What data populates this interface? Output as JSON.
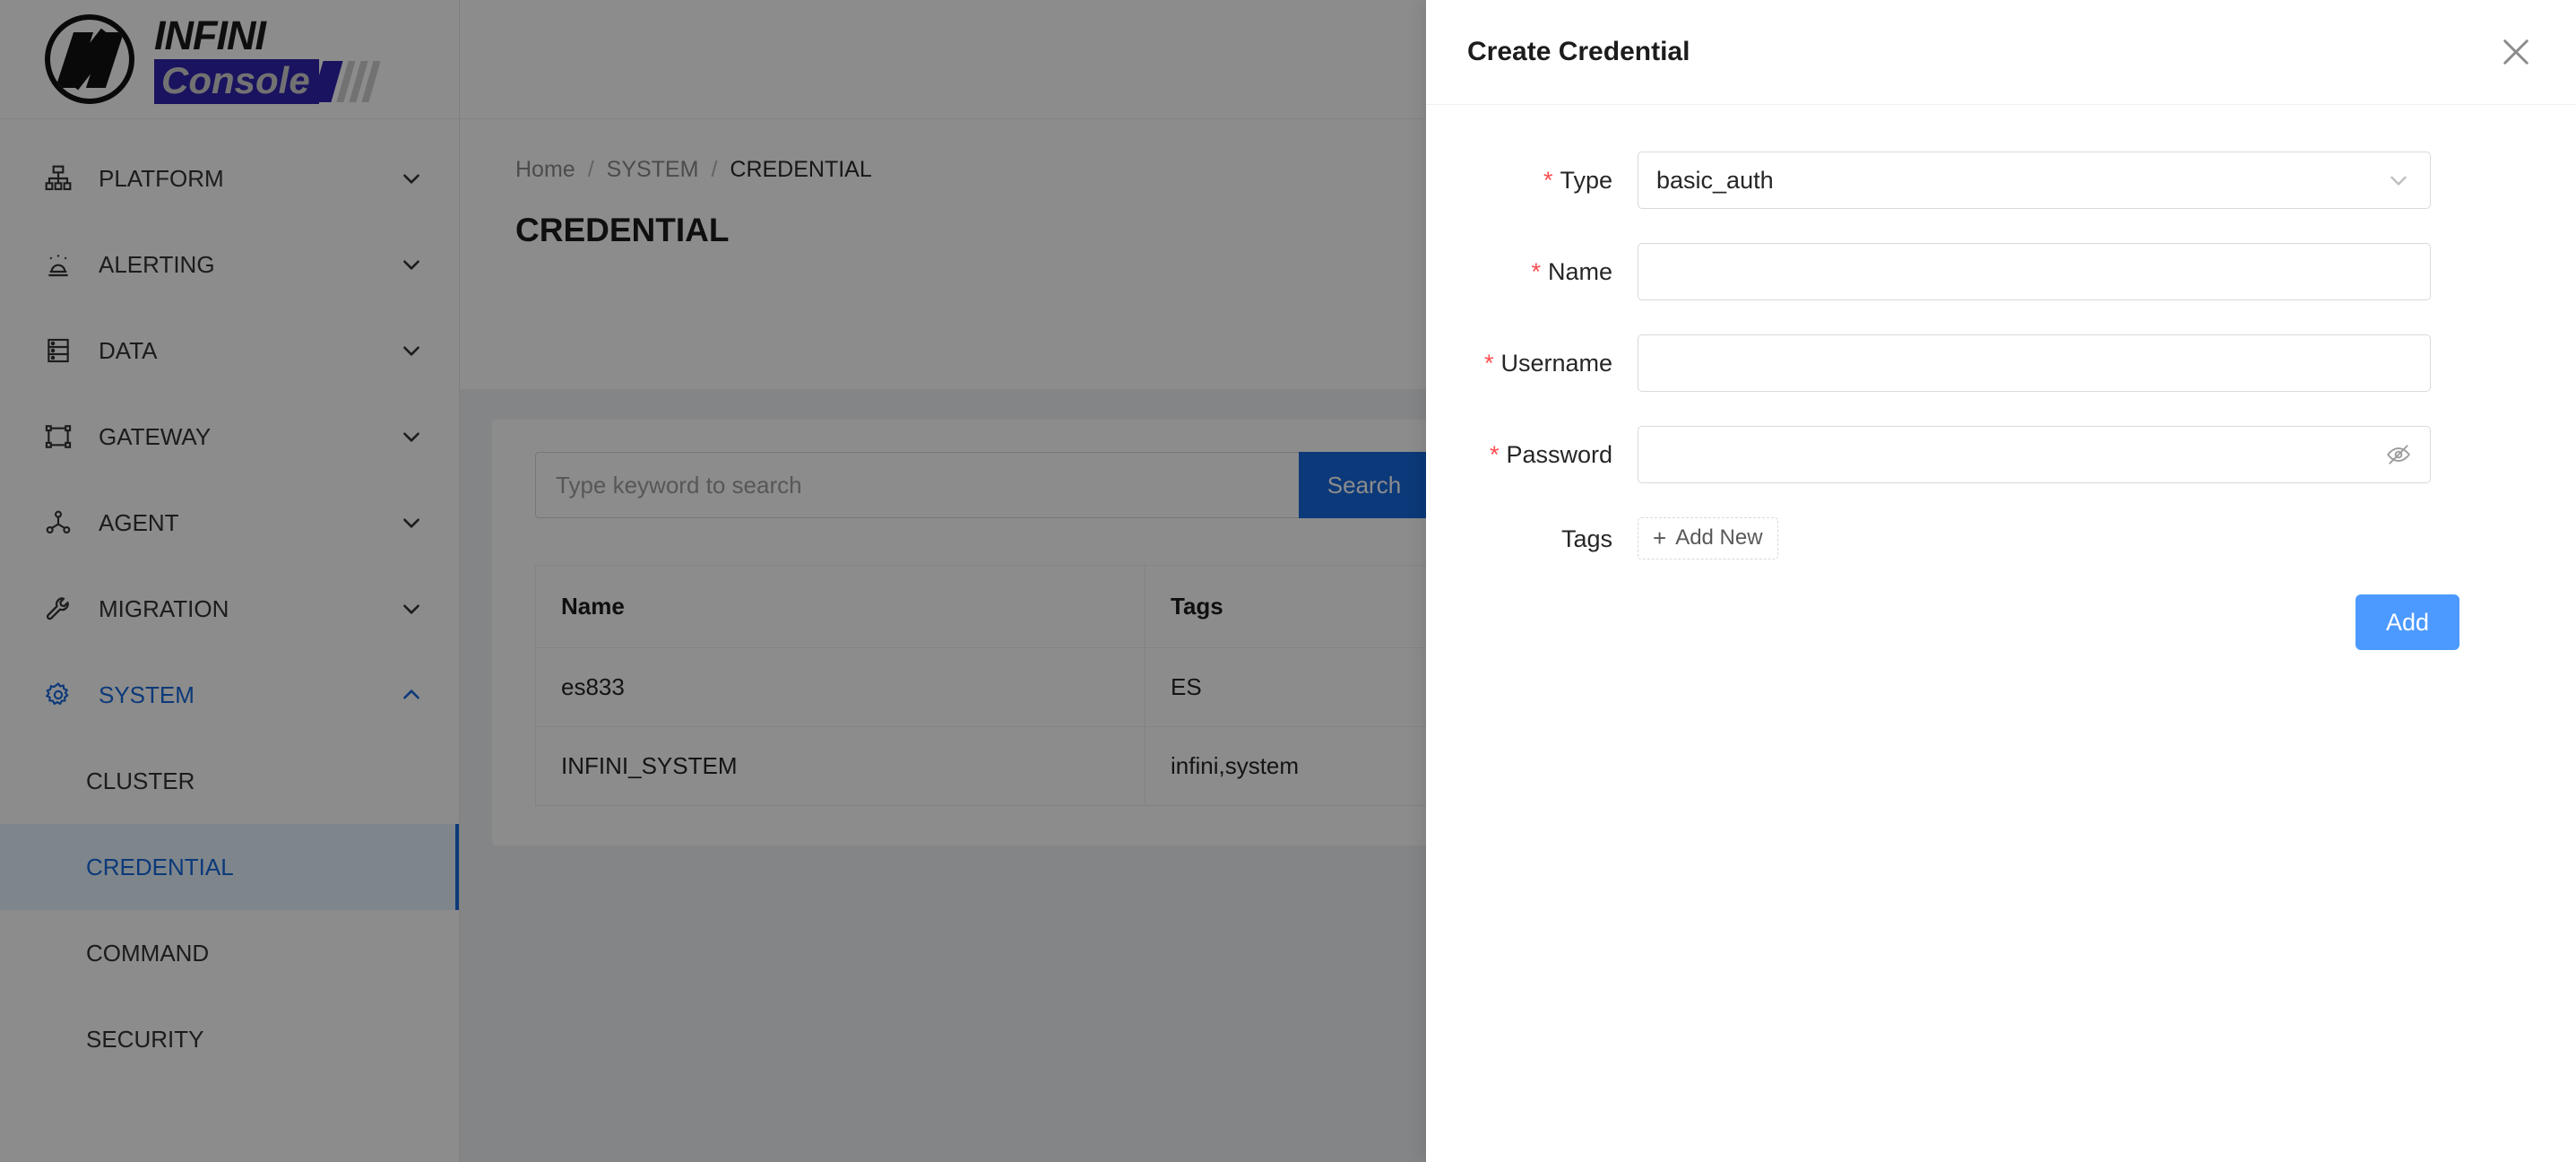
{
  "brand": {
    "name_top": "INFINI",
    "name_bottom": "Console",
    "accent_color": "#3023ae"
  },
  "sidebar": {
    "items": [
      {
        "label": "PLATFORM",
        "icon": "sitemap-icon",
        "chevron": "chevron-down-icon",
        "state": "collapsed"
      },
      {
        "label": "ALERTING",
        "icon": "alarm-icon",
        "chevron": "chevron-down-icon",
        "state": "collapsed"
      },
      {
        "label": "DATA",
        "icon": "database-icon",
        "chevron": "chevron-down-icon",
        "state": "collapsed"
      },
      {
        "label": "GATEWAY",
        "icon": "gateway-icon",
        "chevron": "chevron-down-icon",
        "state": "collapsed"
      },
      {
        "label": "AGENT",
        "icon": "agent-node-icon",
        "chevron": "chevron-down-icon",
        "state": "collapsed"
      },
      {
        "label": "MIGRATION",
        "icon": "wrench-icon",
        "chevron": "chevron-down-icon",
        "state": "collapsed"
      },
      {
        "label": "SYSTEM",
        "icon": "gear-icon",
        "chevron": "chevron-up-icon",
        "state": "expanded"
      }
    ],
    "system_children": [
      {
        "label": "CLUSTER",
        "selected": false
      },
      {
        "label": "CREDENTIAL",
        "selected": true
      },
      {
        "label": "COMMAND",
        "selected": false
      },
      {
        "label": "SECURITY",
        "selected": false
      }
    ],
    "active_color": "#1668dc"
  },
  "page": {
    "breadcrumb": [
      "Home",
      "SYSTEM",
      "CREDENTIAL"
    ],
    "breadcrumb_separator": "/",
    "title": "CREDENTIAL"
  },
  "search": {
    "placeholder": "Type keyword to search",
    "value": "",
    "button_label": "Search",
    "button_color": "#1668dc"
  },
  "table": {
    "columns": [
      "Name",
      "Tags"
    ],
    "rows": [
      {
        "name": "es833",
        "tags": "ES"
      },
      {
        "name": "INFINI_SYSTEM",
        "tags": "infini,system"
      }
    ]
  },
  "drawer": {
    "title": "Create Credential",
    "close_icon": "close-icon",
    "fields": [
      {
        "label": "Type",
        "required": true,
        "control": "select",
        "value": "basic_auth",
        "placeholder": "",
        "suffix_icon": "chevron-down-icon"
      },
      {
        "label": "Name",
        "required": true,
        "control": "text",
        "value": "",
        "placeholder": "",
        "suffix_icon": ""
      },
      {
        "label": "Username",
        "required": true,
        "control": "text",
        "value": "",
        "placeholder": "",
        "suffix_icon": ""
      },
      {
        "label": "Password",
        "required": true,
        "control": "password",
        "value": "",
        "placeholder": "",
        "suffix_icon": "eye-invisible-icon"
      }
    ],
    "tags": {
      "label": "Tags",
      "add_label": "Add New",
      "add_plus": "+"
    },
    "submit": {
      "label": "Add",
      "color": "#4c9aff"
    }
  }
}
